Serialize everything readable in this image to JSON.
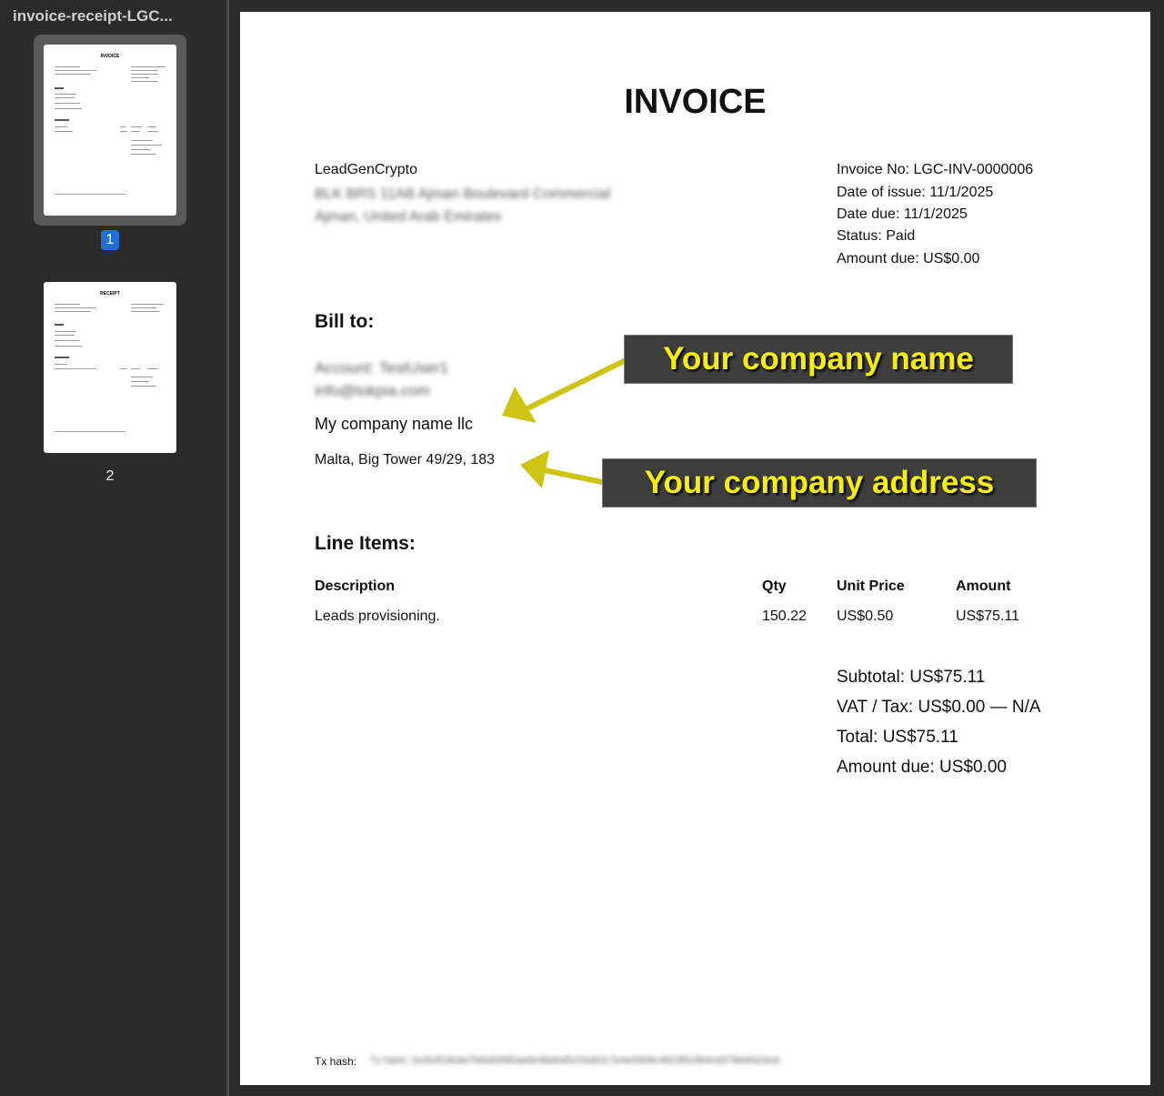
{
  "sidebar": {
    "file_title": "invoice-receipt-LGC...",
    "pages": [
      {
        "number": "1",
        "thumb_title": "INVOICE",
        "selected": true
      },
      {
        "number": "2",
        "thumb_title": "RECEIPT",
        "selected": false
      }
    ]
  },
  "invoice": {
    "title": "INVOICE",
    "seller": {
      "name": "LeadGenCrypto",
      "address_line1": "BLK BRS 11AB Ajman Boulevard Commercial",
      "address_line2": "Ajman, United Arab Emirates"
    },
    "meta": {
      "invoice_no": "Invoice No: LGC-INV-0000006",
      "date_issue": "Date of issue: 11/1/2025",
      "date_due": "Date due: 11/1/2025",
      "status": "Status: Paid",
      "amount_due": "Amount due: US$0.00"
    },
    "bill_to": {
      "heading": "Bill to:",
      "account": "Account: TestUser1",
      "email": "info@tokpia.com",
      "company": "My company name llc",
      "address": "Malta, Big Tower 49/29, 183"
    },
    "line_items": {
      "heading": "Line Items:",
      "columns": [
        "Description",
        "Qty",
        "Unit Price",
        "Amount"
      ],
      "rows": [
        {
          "description": "Leads provisioning.",
          "qty": "150.22",
          "unit_price": "US$0.50",
          "amount": "US$75.11"
        }
      ]
    },
    "totals": {
      "subtotal": "Subtotal: US$75.11",
      "vat": "VAT / Tax: US$0.00 — N/A",
      "total": "Total: US$75.11",
      "amount_due": "Amount due: US$0.00"
    },
    "tx_hash": {
      "label": "Tx hash:",
      "value": "Tx hash: 0x2b4f19cbe7b6a92fd0ae6e4bd4a5c54ab2c7e4e0908c4623f0c9b4cd378ebfa2acb"
    }
  },
  "annotations": {
    "company_name": "Your company name",
    "company_address": "Your company address",
    "color": "#f8f000"
  }
}
